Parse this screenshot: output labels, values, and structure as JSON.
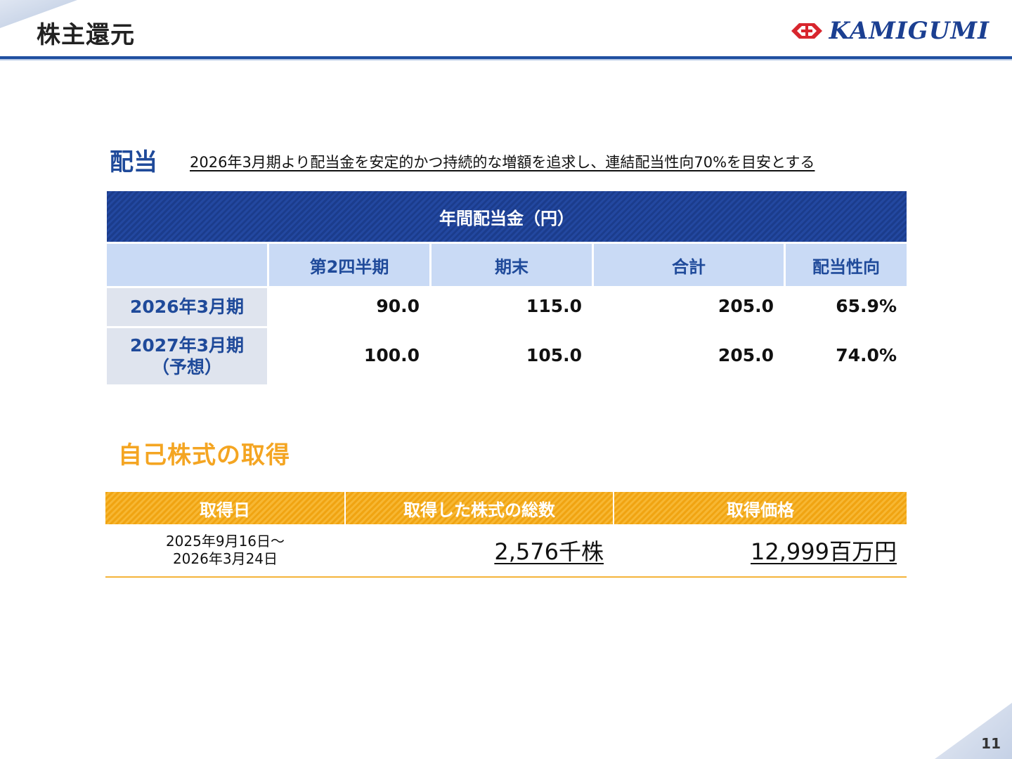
{
  "header": {
    "title": "株主還元",
    "logo_text": "KAMIGUMI"
  },
  "dividend": {
    "section_title": "配当",
    "policy": "2026年3月期より配当金を安定的かつ持続的な増額を追求し、連結配当性向70%を目安とする",
    "table_title": "年間配当金（円）",
    "columns": [
      "第2四半期",
      "期末",
      "合計",
      "配当性向"
    ],
    "rows": [
      {
        "label": "2026年3月期",
        "label2": "",
        "q2": "90.0",
        "year_end": "115.0",
        "total": "205.0",
        "payout": "65.9%"
      },
      {
        "label": "2027年3月期",
        "label2": "（予想）",
        "q2": "100.0",
        "year_end": "105.0",
        "total": "205.0",
        "payout": "74.0%"
      }
    ]
  },
  "buyback": {
    "section_title": "自己株式の取得",
    "columns": [
      "取得日",
      "取得した株式の総数",
      "取得価格"
    ],
    "date_line1": "2025年9月16日～",
    "date_line2": "2026年3月24日",
    "shares": "2,576千株",
    "price": "12,999百万円"
  },
  "footer": {
    "page_number": "11"
  },
  "colors": {
    "navy": "#1b3c8c",
    "light_blue": "#c9daf5",
    "orange": "#f4a522"
  }
}
